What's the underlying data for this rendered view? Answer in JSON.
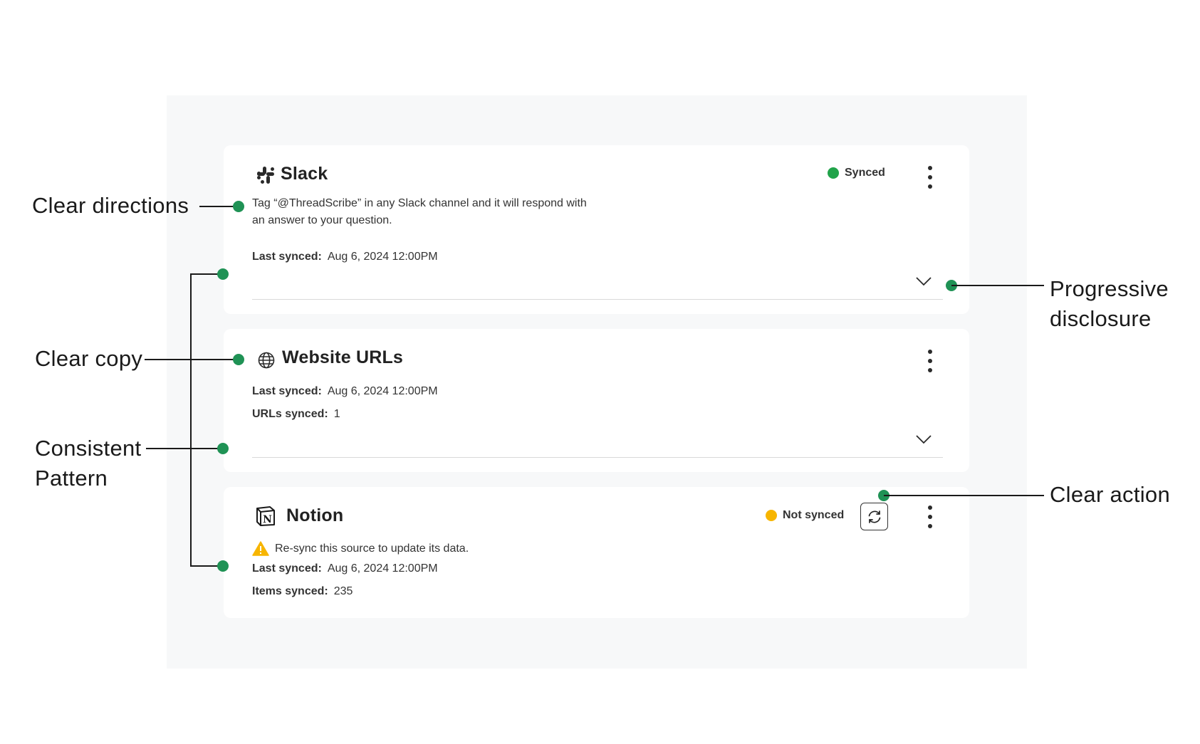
{
  "colors": {
    "accent": "#1f9255",
    "warning": "#f7b500",
    "synced": "#21a34a"
  },
  "cards": {
    "slack": {
      "icon": "slack-icon",
      "title": "Slack",
      "status": "Synced",
      "description_line1": "Tag “@ThreadScribe” in any Slack channel and it will respond with",
      "description_line2": "an answer to your question.",
      "last_synced_label": "Last synced:",
      "last_synced_value": "Aug 6, 2024 12:00PM"
    },
    "website": {
      "icon": "globe-icon",
      "title": "Website URLs",
      "last_synced_label": "Last synced:",
      "last_synced_value": "Aug 6, 2024 12:00PM",
      "urls_label": "URLs synced:",
      "urls_value": "1"
    },
    "notion": {
      "icon": "notion-icon",
      "title": "Notion",
      "status": "Not synced",
      "warning": "Re-sync this source to update its data.",
      "last_synced_label": "Last synced:",
      "last_synced_value": "Aug 6, 2024 12:00PM",
      "items_label": "Items synced:",
      "items_value": "235"
    }
  },
  "annotations": {
    "clear_directions": "Clear directions",
    "clear_copy": "Clear copy",
    "consistent_line1": "Consistent",
    "consistent_line2": "Pattern",
    "progressive_line1": "Progressive",
    "progressive_line2": "disclosure",
    "clear_action": "Clear action"
  }
}
